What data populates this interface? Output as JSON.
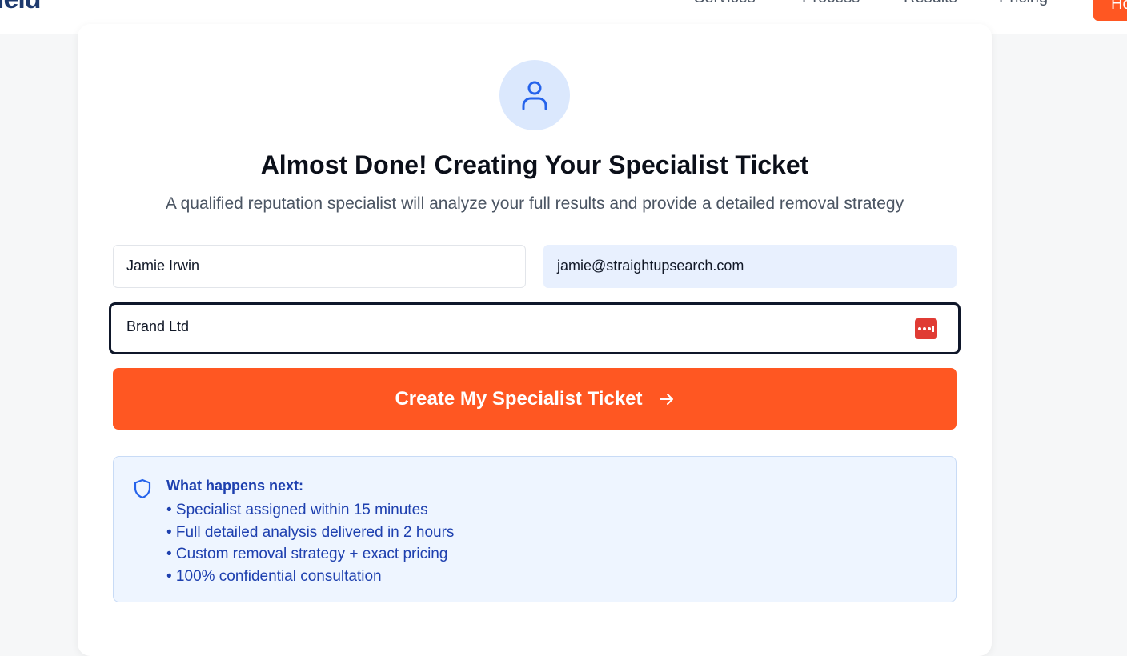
{
  "nav": {
    "logo_text": "ield",
    "items": [
      "Services",
      "Process",
      "Results",
      "Pricing"
    ],
    "cta_label": "Ho"
  },
  "card": {
    "title": "Almost Done! Creating Your Specialist Ticket",
    "subtitle": "A qualified reputation specialist will analyze your full results and provide a detailed removal strategy"
  },
  "form": {
    "name_value": "Jamie Irwin",
    "email_value": "jamie@straightupsearch.com",
    "company_value": "Brand Ltd",
    "submit_label": "Create My Specialist Ticket",
    "submit_icon": "arrow-right-icon"
  },
  "info": {
    "title": "What happens next:",
    "items": [
      "• Specialist assigned within 15 minutes",
      "• Full detailed analysis delivered in 2 hours",
      "• Custom removal strategy + exact pricing",
      "• 100% confidential consultation"
    ]
  },
  "colors": {
    "accent": "#ff5722",
    "info_text": "#1e40af",
    "avatar_bg": "#dbe8fd",
    "icon_blue": "#2563eb"
  }
}
